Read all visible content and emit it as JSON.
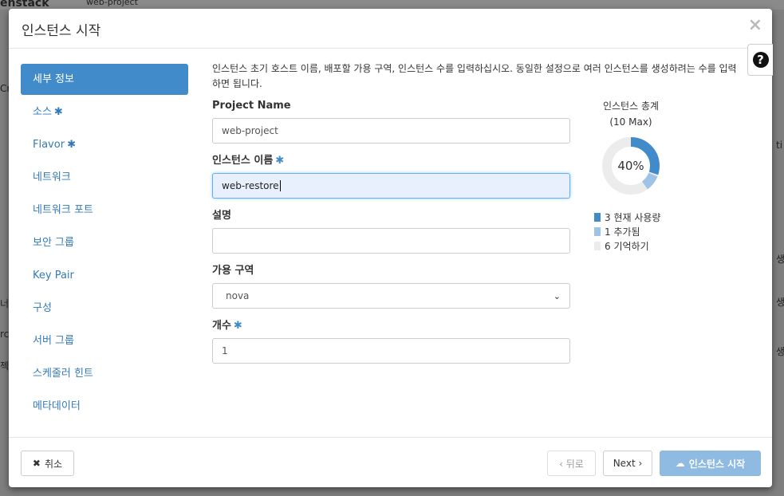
{
  "modal": {
    "title": "인스턴스 시작",
    "close_glyph": "×",
    "help_glyph": "?"
  },
  "nav": {
    "items": [
      {
        "label": "세부 정보",
        "required": false
      },
      {
        "label": "소스",
        "required": true
      },
      {
        "label": "Flavor",
        "required": true
      },
      {
        "label": "네트워크",
        "required": false
      },
      {
        "label": "네트워크 포트",
        "required": false
      },
      {
        "label": "보안 그룹",
        "required": false
      },
      {
        "label": "Key Pair",
        "required": false
      },
      {
        "label": "구성",
        "required": false
      },
      {
        "label": "서버 그룹",
        "required": false
      },
      {
        "label": "스케줄러 힌트",
        "required": false
      },
      {
        "label": "메타데이터",
        "required": false
      }
    ],
    "required_mark": "✱"
  },
  "form": {
    "help_text": "인스턴스 초기 호스트 이름, 배포할 가용 구역, 인스턴스 수를 입력하십시오. 동일한 설정으로 여러 인스턴스를 생성하려는 수를 입력하면 됩니다.",
    "project_name_label": "Project Name",
    "project_name_value": "web-project",
    "instance_name_label": "인스턴스 이름",
    "instance_name_value": "web-restore",
    "description_label": "설명",
    "description_value": "",
    "az_label": "가용 구역",
    "az_value": "nova",
    "count_label": "개수",
    "count_value": "1"
  },
  "quota": {
    "title": "인스턴스 총계",
    "subtitle": "(10 Max)",
    "percent_label": "40%",
    "total": 10,
    "current": 3,
    "added": 1,
    "remaining": 6,
    "legend": [
      {
        "label": "3  현재 사용량",
        "color": "#428bca"
      },
      {
        "label": "1  추가됨",
        "color": "#9ec3e6"
      },
      {
        "label": "6  기억하기",
        "color": "#ececec"
      }
    ]
  },
  "footer": {
    "cancel_label": "취소",
    "back_label": "‹ 뒤로",
    "next_label": "Next ›",
    "launch_label": "인스턴스 시작"
  },
  "background": {
    "fragments": [
      "enstack",
      "web-project",
      "Cr",
      "너",
      "rch",
      "젝",
      "ti",
      "생",
      "생",
      "생"
    ]
  }
}
